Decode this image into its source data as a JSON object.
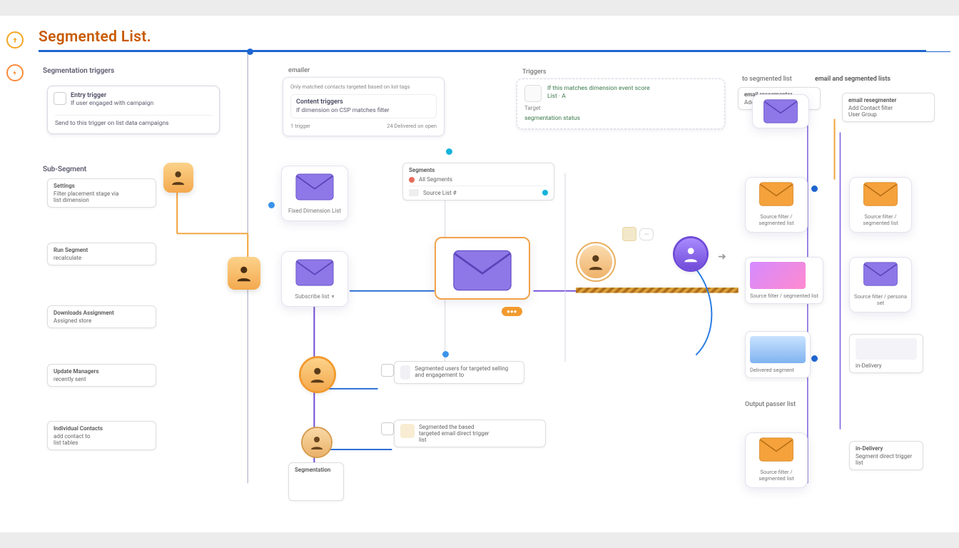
{
  "title": "Segmented List.",
  "sidebar": {
    "icons": [
      "arrow-up-icon",
      "bolt-icon"
    ]
  },
  "labels": {
    "segmentation_triggers": "Segmentation triggers",
    "sub_segment": "Sub-Segment",
    "emailer": "emailer",
    "content_triggers": "Content triggers",
    "segments": "Segments",
    "triggers": "Triggers",
    "email_segmented_lists": "email and segmented lists",
    "to_segmented_list": "to segmented list",
    "output_passer": "Output passer list"
  },
  "top_nodes": {
    "trigger_box": {
      "title": "Entry trigger",
      "line1": "If user engaged with campaign",
      "line2": "Send to this trigger on list data campaigns"
    },
    "emailer_box": {
      "line1": "Only matched contacts targeted based on list tags",
      "content_triggers": "Content triggers",
      "sub1": "If dimension on CSP matches filter",
      "foot1": "1 trigger",
      "foot2": "24 Delivered on open"
    },
    "triggers_box": {
      "line1": "If this matches dimension event score",
      "line2": "List · A",
      "tag_label": "Target",
      "line3": "segmentation status"
    },
    "seg_list_box": {
      "line1": "email resegmenter",
      "line2": "Add Contact filter"
    },
    "right_title_box": {
      "line1": "email resegmenter",
      "line2": "Add Contact filter",
      "line3": "User Group"
    }
  },
  "left_cards": [
    {
      "title": "Settings",
      "line1": "Filter placement stage via",
      "line2": "list dimension",
      "line3": ""
    },
    {
      "title": "Run Segment",
      "line1": "recalculate",
      "line2": ""
    },
    {
      "title": "Downloads Assignment",
      "line1": "Assigned store",
      "line2": ""
    },
    {
      "title": "Update Managers",
      "line1": "recently sent"
    },
    {
      "title": "Individual Contacts",
      "line1": "add contact to",
      "line2": "list tables"
    }
  ],
  "envelope_cards": {
    "mid1": {
      "foot": "Fixed Dimension List"
    },
    "mid2": {
      "foot": "Subscribe list",
      "chev": "▾"
    },
    "large": {
      "foot": ""
    }
  },
  "segments_panel": {
    "title": "Segments",
    "row_label": "All Segments",
    "row2_label": "Source List #"
  },
  "route_cards": [
    {
      "line1": "Segmented users for targeted selling and engagement to"
    },
    {
      "line1": "Segmented the based",
      "line2": "targeted email direct trigger",
      "line3": "list"
    }
  ],
  "chain_card": {
    "title": "Segmentation"
  },
  "right_col": {
    "cards": [
      {
        "type": "env",
        "color": "purple",
        "foot": ""
      },
      {
        "type": "env",
        "color": "orange",
        "foot": "Source filter / segmented list"
      },
      {
        "type": "img",
        "style": "pink",
        "foot": "Source filter / segmented list"
      },
      {
        "type": "img",
        "style": "blue",
        "foot": "Delivered segment"
      },
      {
        "type": "env",
        "color": "orange",
        "foot": "Source filter / segmented list"
      },
      {
        "type": "mini",
        "foot": "in-Delivery"
      }
    ],
    "cards_b": [
      {
        "type": "env",
        "color": "orange",
        "foot": "Source filter / segmented list"
      },
      {
        "type": "env",
        "color": "purple",
        "foot": "Source filter / persona set"
      },
      {
        "type": "mini",
        "foot": "in-Delivery"
      },
      {
        "type": "mini",
        "foot": "Segment direct trigger list"
      }
    ]
  }
}
